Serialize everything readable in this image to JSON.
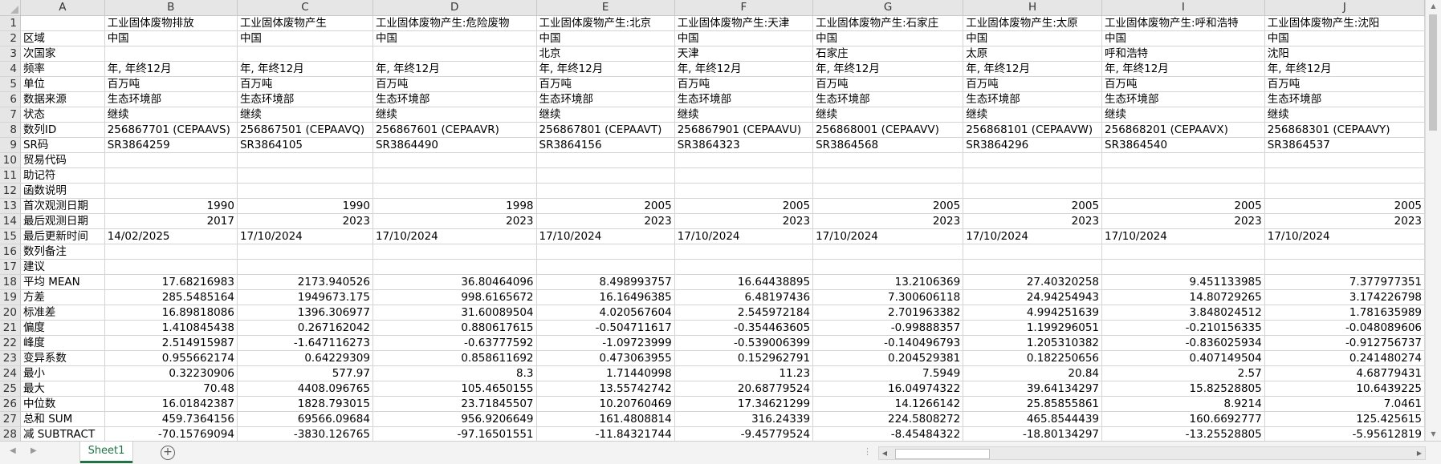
{
  "columns": [
    "A",
    "B",
    "C",
    "D",
    "E",
    "F",
    "G",
    "H",
    "I",
    "J"
  ],
  "rows": [
    {
      "n": "1",
      "cells": [
        "",
        "工业固体废物排放",
        "工业固体废物产生",
        "工业固体废物产生:危险废物",
        "工业固体废物产生:北京",
        "工业固体废物产生:天津",
        "工业固体废物产生:石家庄",
        "工业固体废物产生:太原",
        "工业固体废物产生:呼和浩特",
        "工业固体废物产生:沈阳"
      ]
    },
    {
      "n": "2",
      "cells": [
        "区域",
        "中国",
        "中国",
        "中国",
        "中国",
        "中国",
        "中国",
        "中国",
        "中国",
        "中国"
      ]
    },
    {
      "n": "3",
      "cells": [
        "次国家",
        "",
        "",
        "",
        "北京",
        "天津",
        "石家庄",
        "太原",
        "呼和浩特",
        "沈阳"
      ]
    },
    {
      "n": "4",
      "cells": [
        "频率",
        "年, 年终12月",
        "年, 年终12月",
        "年, 年终12月",
        "年, 年终12月",
        "年, 年终12月",
        "年, 年终12月",
        "年, 年终12月",
        "年, 年终12月",
        "年, 年终12月"
      ]
    },
    {
      "n": "5",
      "cells": [
        "单位",
        "百万吨",
        "百万吨",
        "百万吨",
        "百万吨",
        "百万吨",
        "百万吨",
        "百万吨",
        "百万吨",
        "百万吨"
      ]
    },
    {
      "n": "6",
      "cells": [
        "数据来源",
        "生态环境部",
        "生态环境部",
        "生态环境部",
        "生态环境部",
        "生态环境部",
        "生态环境部",
        "生态环境部",
        "生态环境部",
        "生态环境部"
      ]
    },
    {
      "n": "7",
      "cells": [
        "状态",
        "继续",
        "继续",
        "继续",
        "继续",
        "继续",
        "继续",
        "继续",
        "继续",
        "继续"
      ]
    },
    {
      "n": "8",
      "cells": [
        "数列ID",
        "256867701 (CEPAAVS)",
        "256867501 (CEPAAVQ)",
        "256867601 (CEPAAVR)",
        "256867801 (CEPAAVT)",
        "256867901 (CEPAAVU)",
        "256868001 (CEPAAVV)",
        "256868101 (CEPAAVW)",
        "256868201 (CEPAAVX)",
        "256868301 (CEPAAVY)"
      ]
    },
    {
      "n": "9",
      "cells": [
        "SR码",
        "SR3864259",
        "SR3864105",
        "SR3864490",
        "SR3864156",
        "SR3864323",
        "SR3864568",
        "SR3864296",
        "SR3864540",
        "SR3864537"
      ]
    },
    {
      "n": "10",
      "cells": [
        "贸易代码",
        "",
        "",
        "",
        "",
        "",
        "",
        "",
        "",
        ""
      ]
    },
    {
      "n": "11",
      "cells": [
        "助记符",
        "",
        "",
        "",
        "",
        "",
        "",
        "",
        "",
        ""
      ]
    },
    {
      "n": "12",
      "cells": [
        "函数说明",
        "",
        "",
        "",
        "",
        "",
        "",
        "",
        "",
        ""
      ]
    },
    {
      "n": "13",
      "num": true,
      "cells": [
        "首次观测日期",
        "1990",
        "1990",
        "1998",
        "2005",
        "2005",
        "2005",
        "2005",
        "2005",
        "2005"
      ]
    },
    {
      "n": "14",
      "num": true,
      "cells": [
        "最后观测日期",
        "2017",
        "2023",
        "2023",
        "2023",
        "2023",
        "2023",
        "2023",
        "2023",
        "2023"
      ]
    },
    {
      "n": "15",
      "cells": [
        "最后更新时间",
        "14/02/2025",
        "17/10/2024",
        "17/10/2024",
        "17/10/2024",
        "17/10/2024",
        "17/10/2024",
        "17/10/2024",
        "17/10/2024",
        "17/10/2024"
      ]
    },
    {
      "n": "16",
      "cells": [
        "数列备注",
        "",
        "",
        "",
        "",
        "",
        "",
        "",
        "",
        ""
      ]
    },
    {
      "n": "17",
      "cells": [
        "建议",
        "",
        "",
        "",
        "",
        "",
        "",
        "",
        "",
        ""
      ]
    },
    {
      "n": "18",
      "num": true,
      "cells": [
        "平均 MEAN",
        "17.68216983",
        "2173.940526",
        "36.80464096",
        "8.498993757",
        "16.64438895",
        "13.2106369",
        "27.40320258",
        "9.451133985",
        "7.377977351"
      ]
    },
    {
      "n": "19",
      "num": true,
      "cells": [
        "方差",
        "285.5485164",
        "1949673.175",
        "998.6165672",
        "16.16496385",
        "6.48197436",
        "7.300606118",
        "24.94254943",
        "14.80729265",
        "3.174226798"
      ]
    },
    {
      "n": "20",
      "num": true,
      "cells": [
        "标准差",
        "16.89818086",
        "1396.306977",
        "31.60089504",
        "4.020567604",
        "2.545972184",
        "2.701963382",
        "4.994251639",
        "3.848024512",
        "1.781635989"
      ]
    },
    {
      "n": "21",
      "num": true,
      "cells": [
        "偏度",
        "1.410845438",
        "0.267162042",
        "0.880617615",
        "-0.504711617",
        "-0.354463605",
        "-0.99888357",
        "1.199296051",
        "-0.210156335",
        "-0.048089606"
      ]
    },
    {
      "n": "22",
      "num": true,
      "cells": [
        "峰度",
        "2.514915987",
        "-1.647116273",
        "-0.63777592",
        "-1.09723999",
        "-0.539006399",
        "-0.140496793",
        "1.205310382",
        "-0.836025934",
        "-0.912756737"
      ]
    },
    {
      "n": "23",
      "num": true,
      "cells": [
        "变异系数",
        "0.955662174",
        "0.64229309",
        "0.858611692",
        "0.473063955",
        "0.152962791",
        "0.204529381",
        "0.182250656",
        "0.407149504",
        "0.241480274"
      ]
    },
    {
      "n": "24",
      "num": true,
      "cells": [
        "最小",
        "0.32230906",
        "577.97",
        "8.3",
        "1.71440998",
        "11.23",
        "7.5949",
        "20.84",
        "2.57",
        "4.68779431"
      ]
    },
    {
      "n": "25",
      "num": true,
      "cells": [
        "最大",
        "70.48",
        "4408.096765",
        "105.4650155",
        "13.55742742",
        "20.68779524",
        "16.04974322",
        "39.64134297",
        "15.82528805",
        "10.6439225"
      ]
    },
    {
      "n": "26",
      "num": true,
      "cells": [
        "中位数",
        "16.01842387",
        "1828.793015",
        "23.71845507",
        "10.20760469",
        "17.34621299",
        "14.1266142",
        "25.85855861",
        "8.9214",
        "7.0461"
      ]
    },
    {
      "n": "27",
      "num": true,
      "cells": [
        "总和 SUM",
        "459.7364156",
        "69566.09684",
        "956.9206649",
        "161.4808814",
        "316.24339",
        "224.5808272",
        "465.8544439",
        "160.6692777",
        "125.425615"
      ]
    },
    {
      "n": "28",
      "num": true,
      "cells": [
        "减 SUBTRACT",
        "-70.15769094",
        "-3830.126765",
        "-97.16501551",
        "-11.84321744",
        "-9.45779524",
        "-8.45484322",
        "-18.80134297",
        "-13.25528805",
        "-5.95612819"
      ]
    }
  ],
  "sheet_tab": "Sheet1",
  "add_sheet_symbol": "+",
  "split_dots": "⋮"
}
